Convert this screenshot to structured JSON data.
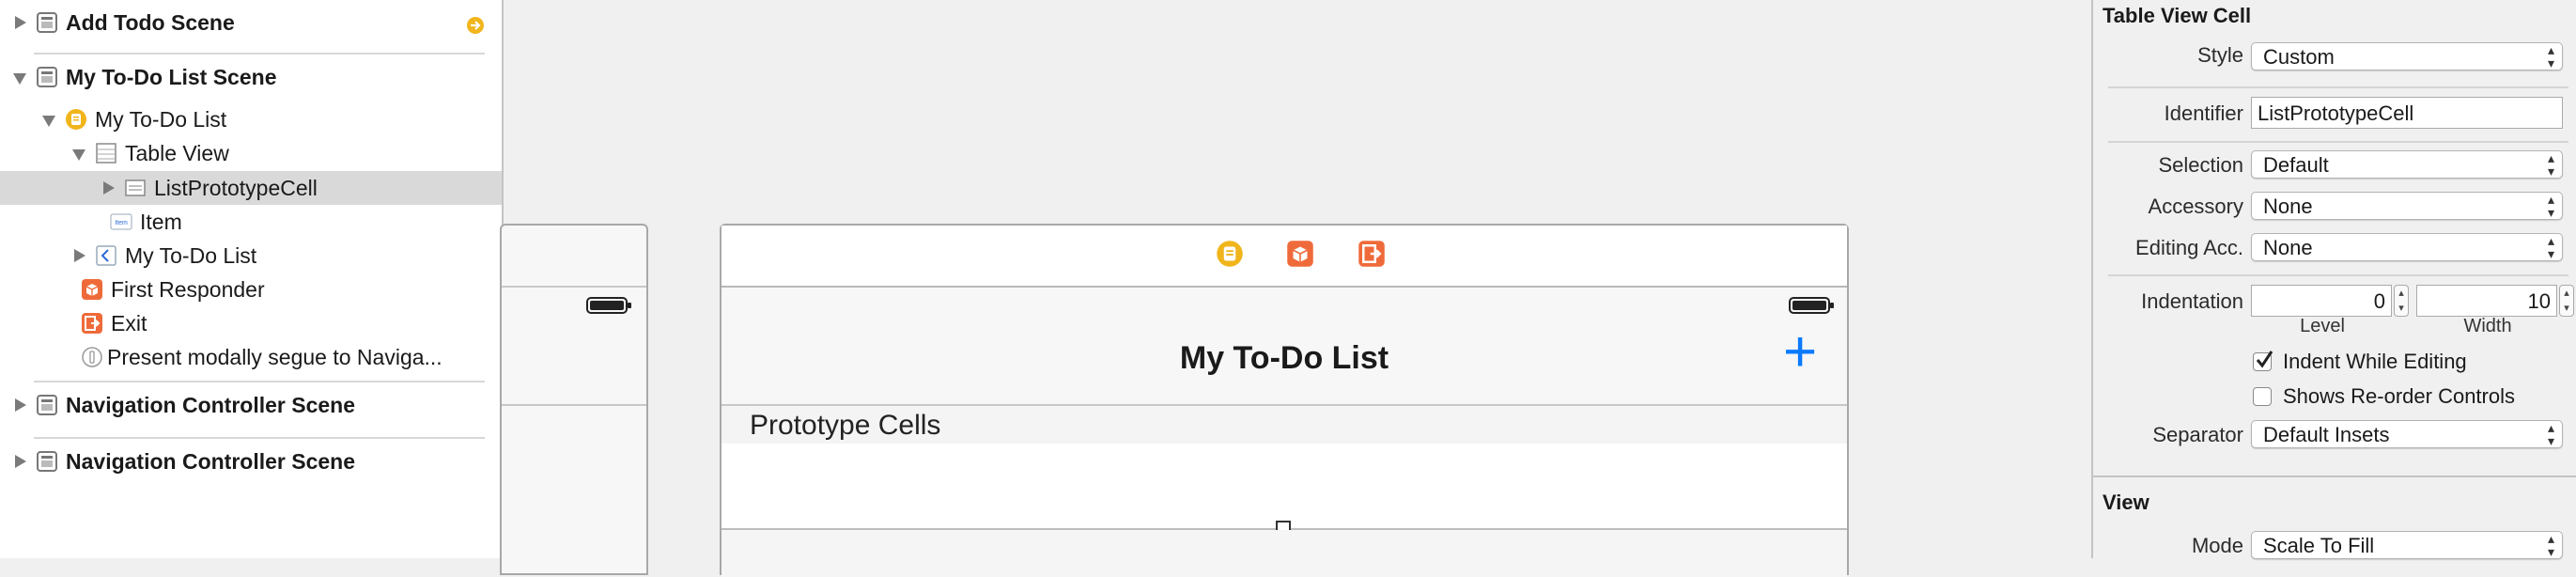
{
  "outline": {
    "items": [
      {
        "label": "Add Todo Scene",
        "bold": true
      },
      {
        "label": "My To-Do List Scene",
        "bold": true
      },
      {
        "label": "My To-Do List"
      },
      {
        "label": "Table View"
      },
      {
        "label": "ListPrototypeCell",
        "selected": true
      },
      {
        "label": "Item"
      },
      {
        "label": "My To-Do List"
      },
      {
        "label": "First Responder"
      },
      {
        "label": "Exit"
      },
      {
        "label": "Present modally segue to Naviga..."
      },
      {
        "label": "Navigation Controller Scene",
        "bold": true
      },
      {
        "label": "Navigation Controller Scene",
        "bold": true
      }
    ],
    "item_icon_text": "Item"
  },
  "canvas": {
    "nav_title": "My To-Do List",
    "section_header": "Prototype Cells",
    "add_symbol": "+"
  },
  "inspector": {
    "cell_section": "Table View Cell",
    "style": {
      "label": "Style",
      "value": "Custom"
    },
    "identifier": {
      "label": "Identifier",
      "value": "ListPrototypeCell"
    },
    "selection": {
      "label": "Selection",
      "value": "Default"
    },
    "accessory": {
      "label": "Accessory",
      "value": "None"
    },
    "editing_acc": {
      "label": "Editing Acc.",
      "value": "None"
    },
    "indentation": {
      "label": "Indentation",
      "level": "0",
      "width": "10",
      "level_label": "Level",
      "width_label": "Width"
    },
    "indent_while_editing": {
      "label": "Indent While Editing",
      "checked": true
    },
    "shows_reorder": {
      "label": "Shows Re-order Controls",
      "checked": false
    },
    "separator": {
      "label": "Separator",
      "value": "Default Insets"
    },
    "view_section": "View",
    "mode": {
      "label": "Mode",
      "value": "Scale To Fill"
    }
  },
  "colors": {
    "accent": "#0a7aff",
    "warning": "#f1b51c",
    "orange": "#ef6a3a",
    "selection_bg": "#d9d9d9"
  }
}
